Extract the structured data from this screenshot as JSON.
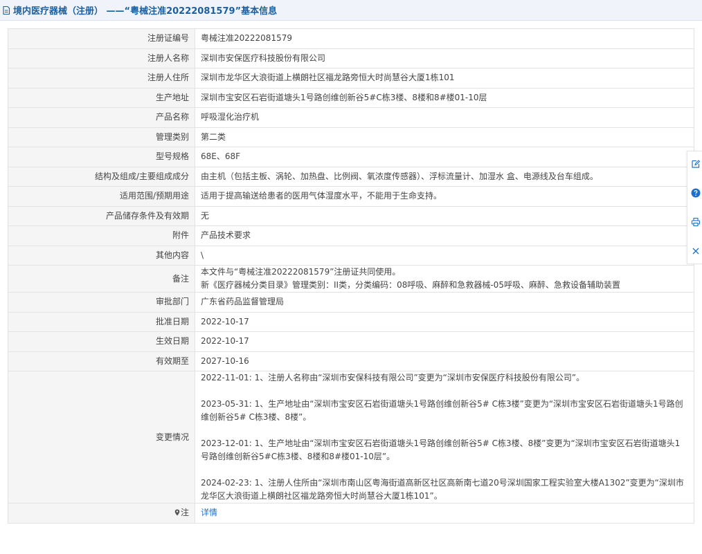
{
  "header": {
    "title": "境内医疗器械（注册） ——“粤械注准20222081579”基本信息"
  },
  "fields": {
    "reg_no": {
      "label": "注册证编号",
      "value": "粤械注准20222081579"
    },
    "registrant": {
      "label": "注册人名称",
      "value": "深圳市安保医疗科技股份有限公司"
    },
    "address": {
      "label": "注册人住所",
      "value": "深圳市龙华区大浪街道上横朗社区福龙路旁恒大时尚慧谷大厦1栋101"
    },
    "production": {
      "label": "生产地址",
      "value": "深圳市宝安区石岩街道塘头1号路创维创新谷5#C栋3楼、8楼和8#楼01-10层"
    },
    "product": {
      "label": "产品名称",
      "value": "呼吸湿化治疗机"
    },
    "category": {
      "label": "管理类别",
      "value": "第二类"
    },
    "model": {
      "label": "型号规格",
      "value": "68E、68F"
    },
    "structure": {
      "label": "结构及组成/主要组成成分",
      "value": "由主机（包括主板、涡轮、加热盘、比例阀、氧浓度传感器）、浮标流量计、加湿水 盒、电源线及台车组成。"
    },
    "scope": {
      "label": "适用范围/预期用途",
      "value": "适用于提高输送给患者的医用气体湿度水平，不能用于生命支持。"
    },
    "storage": {
      "label": "产品储存条件及有效期",
      "value": "无"
    },
    "attachment": {
      "label": "附件",
      "value": "产品技术要求"
    },
    "other": {
      "label": "其他内容",
      "value": "\\"
    },
    "remark": {
      "label": "备注",
      "lines": [
        "本文件与“粤械注准20222081579”注册证共同使用。",
        "新《医疗器械分类目录》管理类别：II类，分类编码：08呼吸、麻醉和急救器械-05呼吸、麻醉、急救设备辅助装置"
      ]
    },
    "authority": {
      "label": "审批部门",
      "value": "广东省药品监督管理局"
    },
    "approve_date": {
      "label": "批准日期",
      "value": "2022-10-17"
    },
    "effective": {
      "label": "生效日期",
      "value": "2022-10-17"
    },
    "expiry": {
      "label": "有效期至",
      "value": "2027-10-16"
    },
    "changes": {
      "label": "变更情况",
      "entries": [
        "2022-11-01: 1、注册人名称由“深圳市安保科技有限公司”变更为“深圳市安保医疗科技股份有限公司”。",
        "2023-05-31: 1、生产地址由“深圳市宝安区石岩街道塘头1号路创维创新谷5# C栋3楼”变更为“深圳市宝安区石岩街道塘头1号路创维创新谷5# C栋3楼、8楼”。",
        "2023-12-01: 1、生产地址由“深圳市宝安区石岩街道塘头1号路创维创新谷5# C栋3楼、8楼”变更为“深圳市宝安区石岩街道塘头1号路创维创新谷5#C栋3楼、8楼和8#楼01-10层”。",
        "2024-02-23: 1、注册人住所由“深圳市南山区粤海街道高新区社区高新南七道20号深圳国家工程实验室大楼A1302”变更为“深圳市龙华区大浪街道上横朗社区福龙路旁恒大时尚慧谷大厦1栋101”。"
      ]
    },
    "note": {
      "label": "注",
      "link": "详情"
    }
  },
  "colors": {
    "title": "#1c5f9f",
    "link": "#1e6fc8",
    "label_bg": "#f5f5f5",
    "header_bg": "#f0f4fa",
    "border": "#e2e2e2"
  },
  "side_tools": [
    "edit-icon",
    "help-icon",
    "print-icon",
    "close-icon"
  ]
}
